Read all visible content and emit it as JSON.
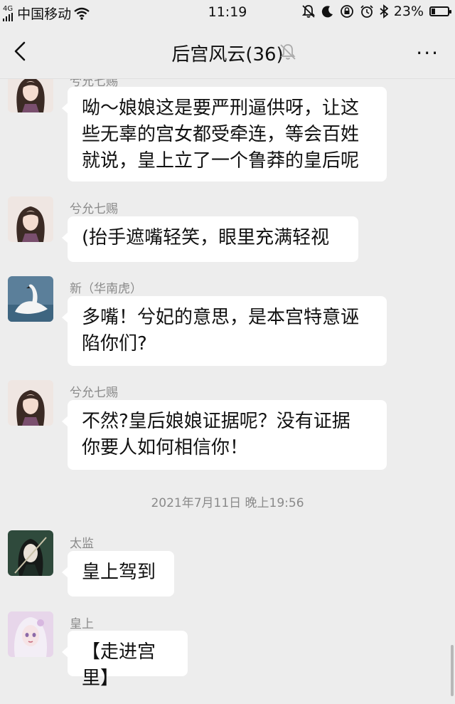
{
  "status_bar": {
    "signal": "4G",
    "carrier": "中国移动",
    "time": "11:19",
    "battery": "23%",
    "battery_level": 0.23,
    "icons": [
      "wifi-icon",
      "bell-off-icon",
      "moon-icon",
      "rotation-lock-icon",
      "alarm-icon",
      "bluetooth-icon",
      "battery-icon"
    ]
  },
  "nav": {
    "title": "后宫风云(36)",
    "more": "···"
  },
  "messages": [
    {
      "sender": "兮允七赐",
      "text": [
        "呦～娘娘这是要严刑逼供呀，让这",
        "些无辜的宫女都受牵连，等会百姓",
        "就说，皇上立了一个鲁莽的皇后呢"
      ]
    },
    {
      "sender": "兮允七赐",
      "text": [
        "(抬手遮嘴轻笑，眼里充满轻视"
      ]
    },
    {
      "sender": "新（华南虎）",
      "text": [
        "多嘴！兮妃的意思，是本宫特意诬",
        "陷你们?"
      ]
    },
    {
      "sender": "兮允七赐",
      "text": [
        "不然?皇后娘娘证据呢？没有证据",
        "你要人如何相信你！"
      ]
    },
    {
      "sender": "太监",
      "text": [
        "皇上驾到"
      ]
    },
    {
      "sender": "皇上",
      "text": [
        "【走进宫里】"
      ]
    }
  ],
  "timestamp": "2021年7月11日 晚上19:56"
}
